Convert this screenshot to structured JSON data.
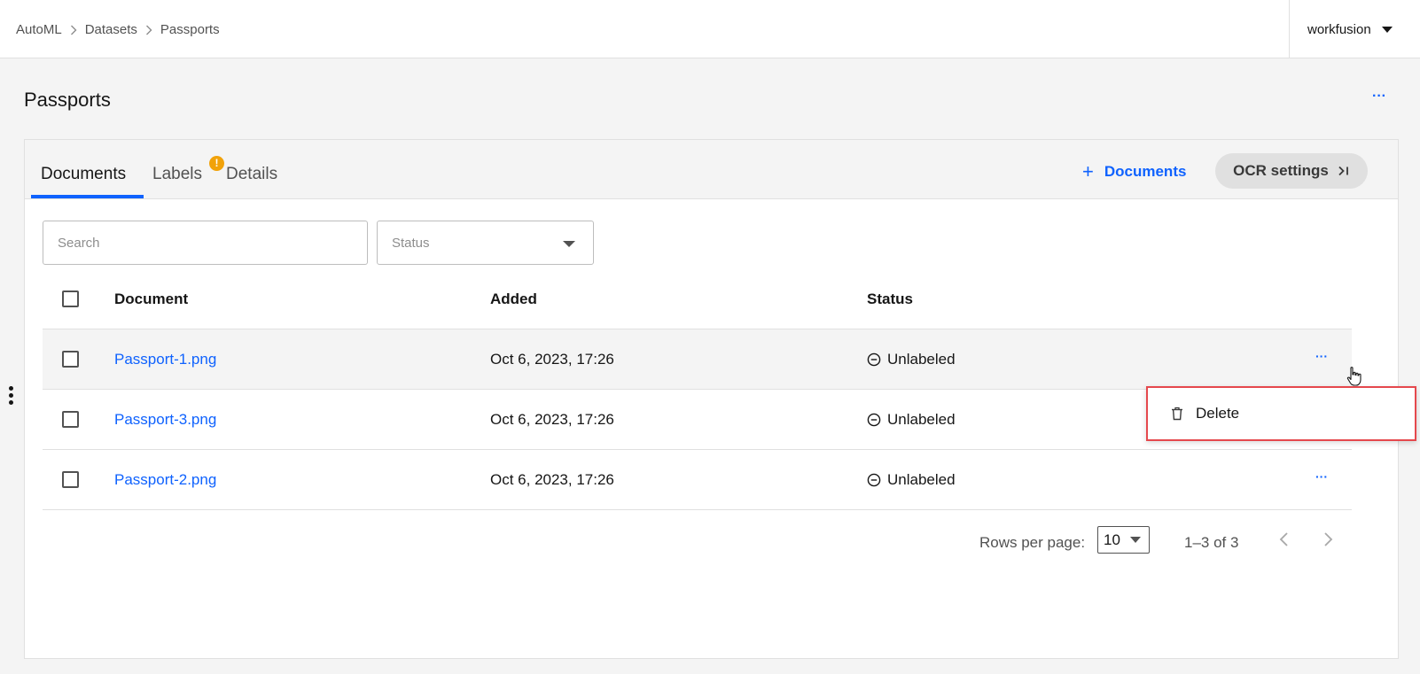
{
  "breadcrumb": {
    "items": [
      "AutoML",
      "Datasets"
    ],
    "current": "Passports"
  },
  "user": {
    "name": "workfusion"
  },
  "page": {
    "title": "Passports",
    "more": "···"
  },
  "tabs": [
    {
      "label": "Documents",
      "active": true
    },
    {
      "label": "Labels",
      "badge": "!"
    },
    {
      "label": "Details"
    }
  ],
  "actions": {
    "add_documents": "Documents",
    "ocr_settings": "OCR settings"
  },
  "filters": {
    "search_placeholder": "Search",
    "status_placeholder": "Status"
  },
  "table": {
    "columns": [
      "Document",
      "Added",
      "Status"
    ],
    "rows": [
      {
        "document": "Passport-1.png",
        "added": "Oct 6, 2023, 17:26",
        "status": "Unlabeled"
      },
      {
        "document": "Passport-3.png",
        "added": "Oct 6, 2023, 17:26",
        "status": "Unlabeled"
      },
      {
        "document": "Passport-2.png",
        "added": "Oct 6, 2023, 17:26",
        "status": "Unlabeled"
      }
    ],
    "row_more": "···"
  },
  "context_menu": {
    "items": [
      {
        "label": "Delete",
        "icon": "trash-icon"
      }
    ]
  },
  "pagination": {
    "rows_per_page_label": "Rows per page:",
    "rows_per_page": "10",
    "range": "1–3 of 3"
  },
  "colors": {
    "accent": "#0f62fe",
    "badge": "#f1a20a",
    "highlight_border": "#e5484d"
  }
}
